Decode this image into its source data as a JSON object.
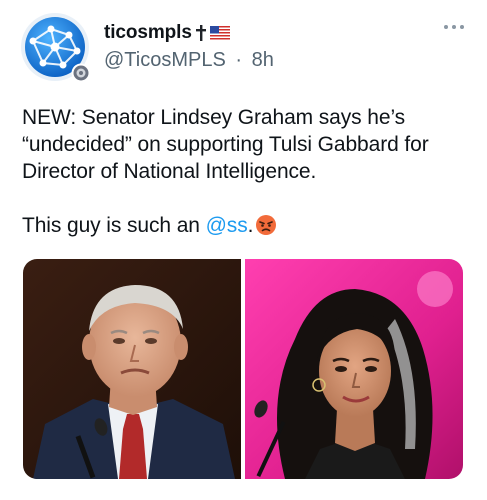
{
  "author": {
    "display_name": "ticosmpls",
    "name_emojis": [
      "latin-cross-emoji",
      "us-flag-emoji"
    ],
    "handle": "@TicosMPLS",
    "separator": "·",
    "time": "8h",
    "avatar_icon": "globe-network-icon",
    "badge_icon": "seal-badge-icon"
  },
  "tweet": {
    "line1": "NEW: Senator Lindsey Graham says he’s “undecided” on supporting Tulsi Gabbard for Director of National Intelligence.",
    "line2_prefix": "This guy is such an ",
    "mention": "@ss",
    "line2_suffix": ".",
    "emoji": "angry-face-emoji"
  },
  "media": {
    "photos": [
      {
        "subject": "man-in-suit-photo"
      },
      {
        "subject": "woman-on-pink-stage-photo"
      }
    ]
  },
  "colors": {
    "accent": "#1d9bf0",
    "text": "#0f1419",
    "secondary": "#536471"
  }
}
